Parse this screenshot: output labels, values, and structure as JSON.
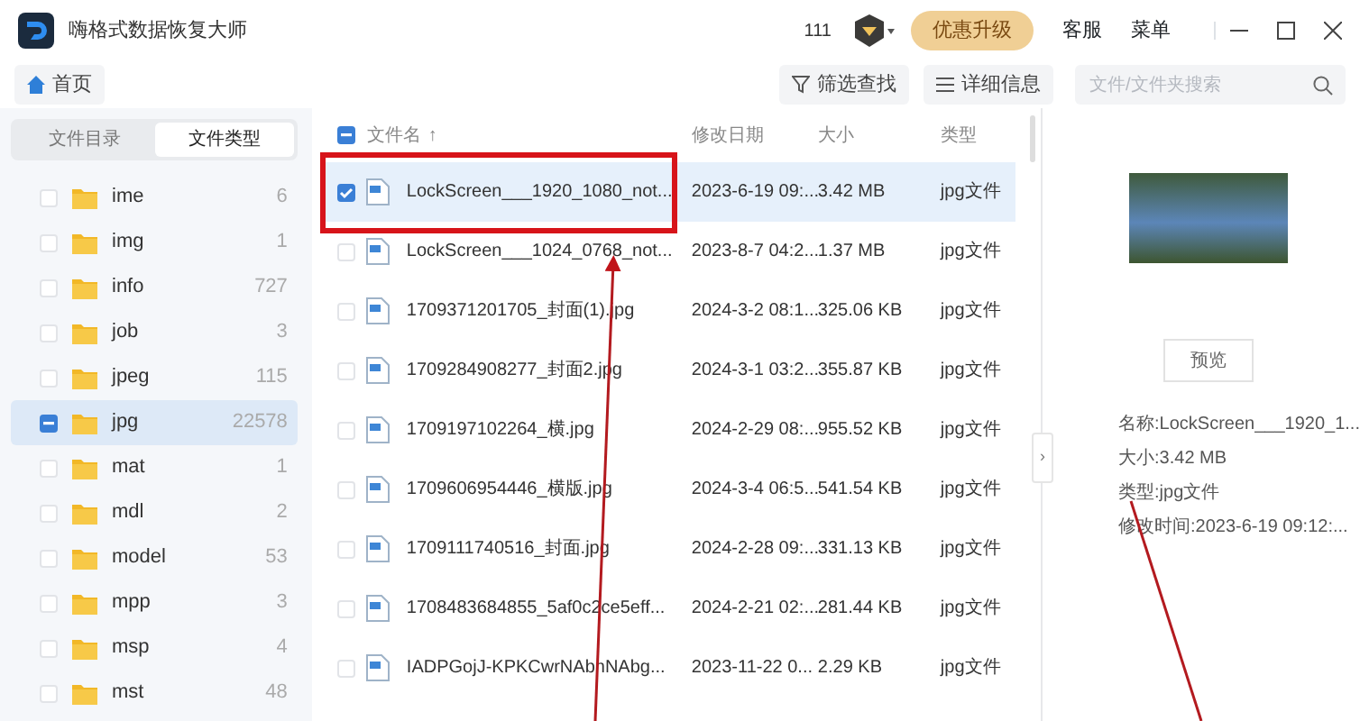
{
  "window": {
    "title": "嗨格式数据恢复大师",
    "count": "111",
    "upgrade": "优惠升级",
    "links": [
      "客服",
      "菜单"
    ]
  },
  "toolbar": {
    "home": "首页",
    "filter": "筛选查找",
    "details": "详细信息",
    "search": {
      "placeholder": "文件/文件夹搜索"
    }
  },
  "sidebar": {
    "tabs": [
      {
        "label": "文件目录",
        "selected": false
      },
      {
        "label": "文件类型",
        "selected": true
      }
    ],
    "items": [
      {
        "name": "ime",
        "count": "6",
        "partial": false,
        "selected": false
      },
      {
        "name": "img",
        "count": "1",
        "partial": false,
        "selected": false
      },
      {
        "name": "info",
        "count": "727",
        "partial": false,
        "selected": false
      },
      {
        "name": "job",
        "count": "3",
        "partial": false,
        "selected": false
      },
      {
        "name": "jpeg",
        "count": "115",
        "partial": false,
        "selected": false
      },
      {
        "name": "jpg",
        "count": "22578",
        "partial": true,
        "selected": true
      },
      {
        "name": "mat",
        "count": "1",
        "partial": false,
        "selected": false
      },
      {
        "name": "mdl",
        "count": "2",
        "partial": false,
        "selected": false
      },
      {
        "name": "model",
        "count": "53",
        "partial": false,
        "selected": false
      },
      {
        "name": "mpp",
        "count": "3",
        "partial": false,
        "selected": false
      },
      {
        "name": "msp",
        "count": "4",
        "partial": false,
        "selected": false
      },
      {
        "name": "mst",
        "count": "48",
        "partial": false,
        "selected": false
      }
    ]
  },
  "table": {
    "columns": [
      "文件名",
      "修改日期",
      "大小",
      "类型"
    ],
    "sort_mark": "↑",
    "header_partial": true,
    "rows": [
      {
        "name": "LockScreen___1920_1080_not...",
        "date": "2023-6-19 09:...",
        "size": "3.42 MB",
        "type": "jpg文件",
        "checked": true,
        "selected": true
      },
      {
        "name": "LockScreen___1024_0768_not...",
        "date": "2023-8-7 04:2...",
        "size": "1.37 MB",
        "type": "jpg文件",
        "checked": false,
        "selected": false
      },
      {
        "name": "1709371201705_封面(1).jpg",
        "date": "2024-3-2 08:1...",
        "size": "325.06 KB",
        "type": "jpg文件",
        "checked": false,
        "selected": false
      },
      {
        "name": "1709284908277_封面2.jpg",
        "date": "2024-3-1 03:2...",
        "size": "355.87 KB",
        "type": "jpg文件",
        "checked": false,
        "selected": false
      },
      {
        "name": "1709197102264_横.jpg",
        "date": "2024-2-29 08:...",
        "size": "955.52 KB",
        "type": "jpg文件",
        "checked": false,
        "selected": false
      },
      {
        "name": "1709606954446_横版.jpg",
        "date": "2024-3-4 06:5...",
        "size": "541.54 KB",
        "type": "jpg文件",
        "checked": false,
        "selected": false
      },
      {
        "name": "1709111740516_封面.jpg",
        "date": "2024-2-28 09:...",
        "size": "331.13 KB",
        "type": "jpg文件",
        "checked": false,
        "selected": false
      },
      {
        "name": "1708483684855_5af0c2ce5eff...",
        "date": "2024-2-21 02:...",
        "size": "281.44 KB",
        "type": "jpg文件",
        "checked": false,
        "selected": false
      },
      {
        "name": "IADPGojJ-KPKCwrNAbnNAbg...",
        "date": "2023-11-22 0...",
        "size": "2.29 KB",
        "type": "jpg文件",
        "checked": false,
        "selected": false
      }
    ]
  },
  "details": {
    "collapse": "›",
    "preview_button": "预览",
    "lines": [
      "名称:LockScreen___1920_1...",
      "大小:3.42 MB",
      "类型:jpg文件",
      "修改时间:2023-6-19 09:12:..."
    ]
  },
  "annotations": [
    {
      "kind": "box"
    },
    {
      "kind": "arrow"
    },
    {
      "kind": "line"
    }
  ]
}
